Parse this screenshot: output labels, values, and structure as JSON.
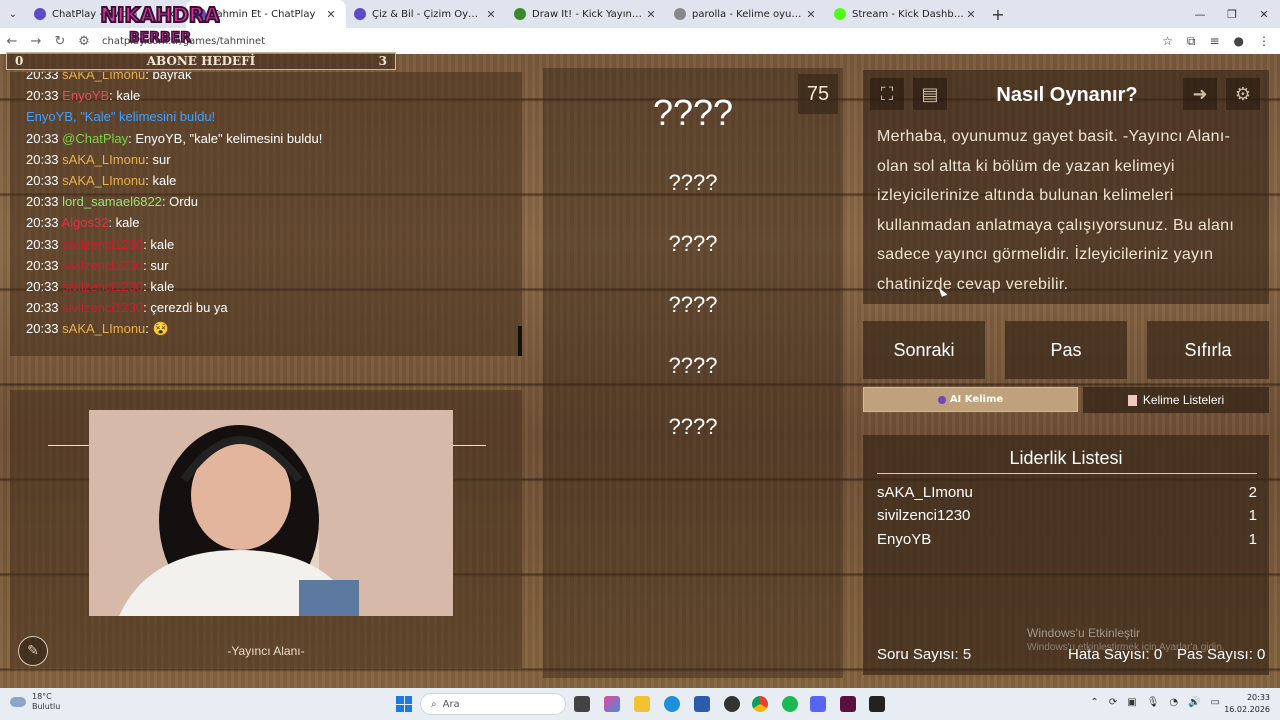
{
  "browser": {
    "tabs": [
      {
        "label": "ChatPlay - Twitch",
        "active": false,
        "color": "#5a4cc7"
      },
      {
        "label": "Tahmin Et - ChatPlay",
        "active": true,
        "color": "#5a4cc7"
      },
      {
        "label": "Çiz & Bil - Çizim Oyunu",
        "active": false,
        "color": "#5a4cc7"
      },
      {
        "label": "Draw It! - Kick Yayınları İçin Çizim",
        "active": false,
        "color": "#3a8a2a"
      },
      {
        "label": "parolla - Kelime oyunu. Günlük",
        "active": false,
        "color": "#888888"
      },
      {
        "label": "Stream - Kick Dashboard",
        "active": false,
        "color": "#53fc18"
      }
    ],
    "url": "chatplay.com.tr/games/tahminet"
  },
  "subscriber_goal": {
    "left": "0",
    "label": "ABONE HEDEFİ",
    "right": "3"
  },
  "chat": {
    "messages": [
      {
        "time": "20:33",
        "user": "sAKA_LImonu",
        "user_color": "#e8b04a",
        "text": ": bayrak"
      },
      {
        "time": "20:33",
        "user": "EnyoYB",
        "user_color": "#e84a5f",
        "text": ": kale"
      },
      {
        "time": "",
        "user": "EnyoYB, \"Kale\" kelimesini buldu!",
        "user_color": "#3fa0ff",
        "text": ""
      },
      {
        "time": "20:33",
        "user": "@ChatPlay",
        "user_color": "#7bd34a",
        "text": ": EnyoYB, \"kale\" kelimesini buldu!"
      },
      {
        "time": "20:33",
        "user": "sAKA_LImonu",
        "user_color": "#e8b04a",
        "text": ": sur"
      },
      {
        "time": "20:33",
        "user": "sAKA_LImonu",
        "user_color": "#e8b04a",
        "text": ": kale"
      },
      {
        "time": "20:33",
        "user": "lord_samael6822",
        "user_color": "#9be07a",
        "text": ": Ordu"
      },
      {
        "time": "20:33",
        "user": "Algos32",
        "user_color": "#e03040",
        "text": ": kale"
      },
      {
        "time": "20:33",
        "user": "sivilzenci1230",
        "user_color": "#d01a2a",
        "text": ": kale"
      },
      {
        "time": "20:33",
        "user": "sivilzenci1230",
        "user_color": "#d01a2a",
        "text": ": sur"
      },
      {
        "time": "20:33",
        "user": "sivilzenci1230",
        "user_color": "#d01a2a",
        "text": ": kale"
      },
      {
        "time": "20:33",
        "user": "sivilzenci1230",
        "user_color": "#d01a2a",
        "text": ": çerezdi bu ya"
      },
      {
        "time": "20:33",
        "user": "sAKA_LImonu",
        "user_color": "#e8b04a",
        "text": ": 😵"
      }
    ]
  },
  "stream_area_label": "-Yayıncı Alanı-",
  "game": {
    "timer": "75",
    "main_word": "????",
    "hidden_words": [
      "????",
      "????",
      "????",
      "????",
      "????"
    ]
  },
  "howto": {
    "title": "Nasıl Oynanır?",
    "text": "Merhaba, oyunumuz gayet basit. -Yayıncı Alanı- olan sol altta ki bölüm de yazan kelimeyi izleyicilerinize altında bulunan kelimeleri kullanmadan anlatmaya çalışıyorsunuz. Bu alanı sadece yayıncı görmelidir. İzleyicileriniz yayın chatinizde cevap verebilir."
  },
  "controls": {
    "next": "Sonraki",
    "pass": "Pas",
    "reset": "Sıfırla",
    "ai_word": "AI Kelime",
    "word_lists": "Kelime Listeleri"
  },
  "leaderboard": {
    "title": "Liderlik Listesi",
    "rows": [
      {
        "name": "sAKA_LImonu",
        "score": "2"
      },
      {
        "name": "sivilzenci1230",
        "score": "1"
      },
      {
        "name": "EnyoYB",
        "score": "1"
      }
    ]
  },
  "stats": {
    "questions": "Soru Sayısı: 5",
    "errors": "Hata Sayısı: 0",
    "passes": "Pas Sayısı: 0"
  },
  "watermark": {
    "line1": "Windows'u Etkinleştir",
    "line2": "Windows'u etkinleştirmek için Ayarlar'a gidin."
  },
  "taskbar": {
    "weather_temp": "18°C",
    "weather_desc": "Bulutlu",
    "search_placeholder": "Ara",
    "time": "20:33",
    "date": "16.02.2026"
  }
}
